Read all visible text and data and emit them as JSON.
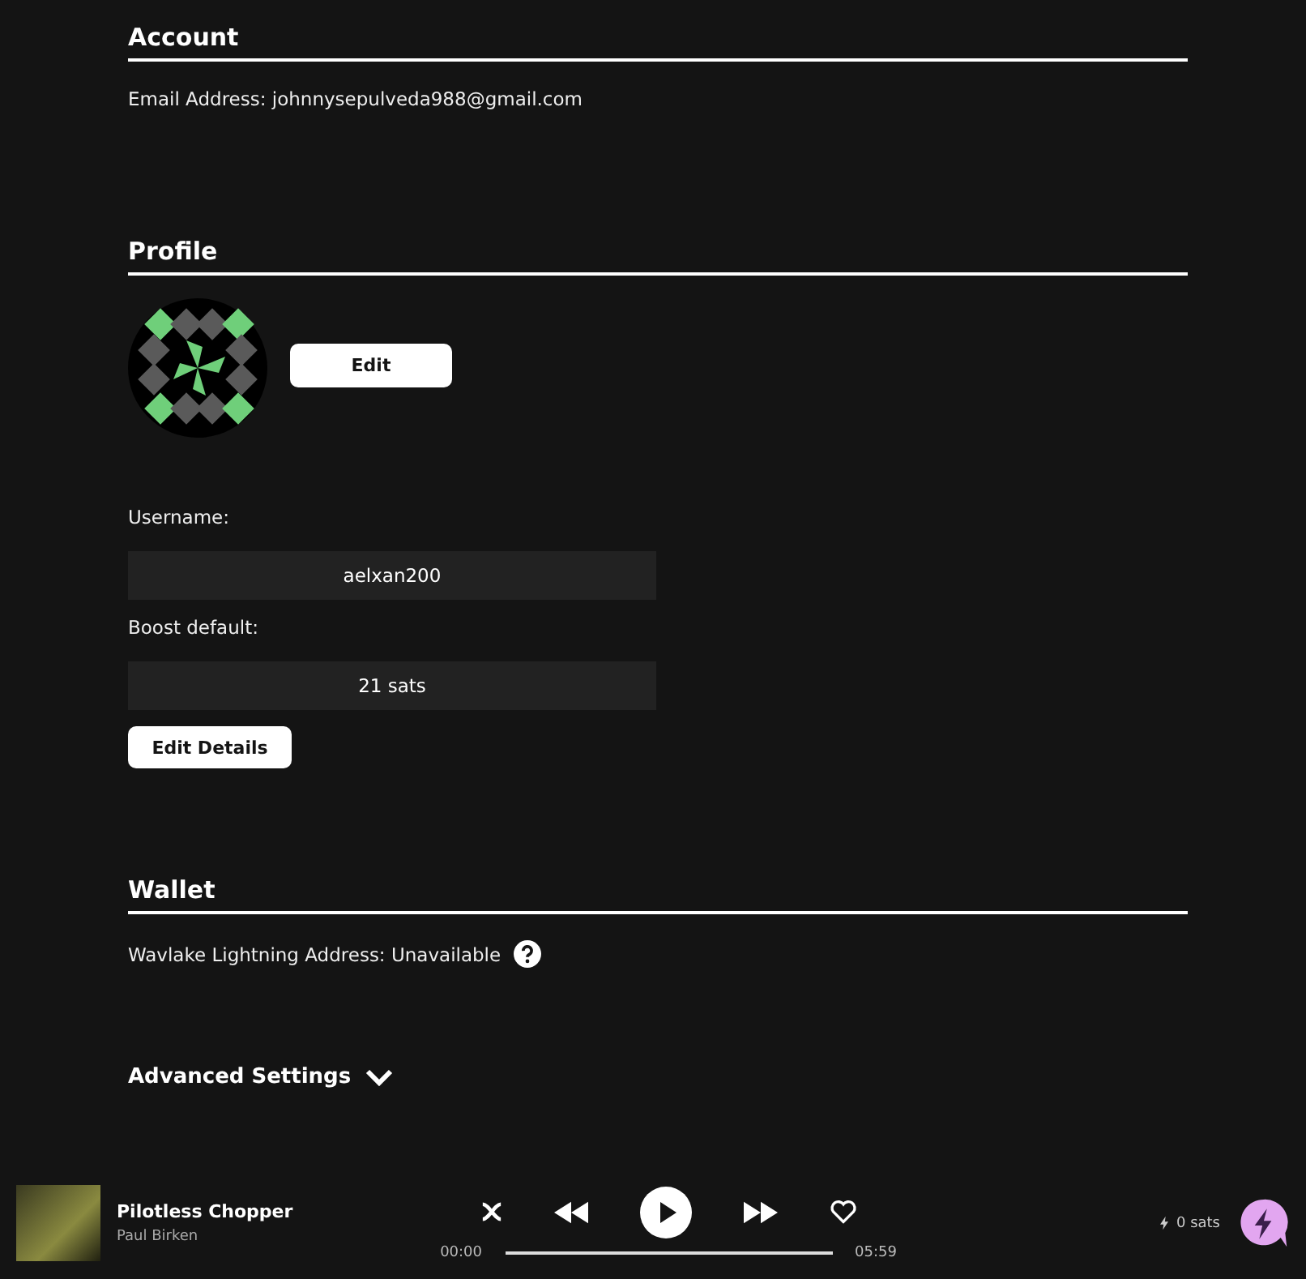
{
  "sections": [
    {
      "kind": "account",
      "title": "Account",
      "email_label": "Email Address:",
      "email": "johnnysepulveda988@gmail.com"
    },
    {
      "kind": "profile",
      "title": "Profile",
      "edit_button": "Edit",
      "fields": [
        {
          "label": "Username:",
          "value": "aelxan200"
        },
        {
          "label": "Boost default:",
          "value": "21 sats"
        }
      ],
      "details_button": "Edit Details"
    },
    {
      "kind": "wallet",
      "title": "Wallet",
      "address_label": "Wavlake Lightning Address:",
      "address_value": "Unavailable"
    }
  ],
  "advanced": {
    "label": "Advanced Settings",
    "expanded": false
  },
  "player": {
    "title": "Pilotless Chopper",
    "artist": "Paul Birken",
    "elapsed": "00:00",
    "duration": "05:59",
    "liked": false,
    "balance": "0 sats"
  }
}
